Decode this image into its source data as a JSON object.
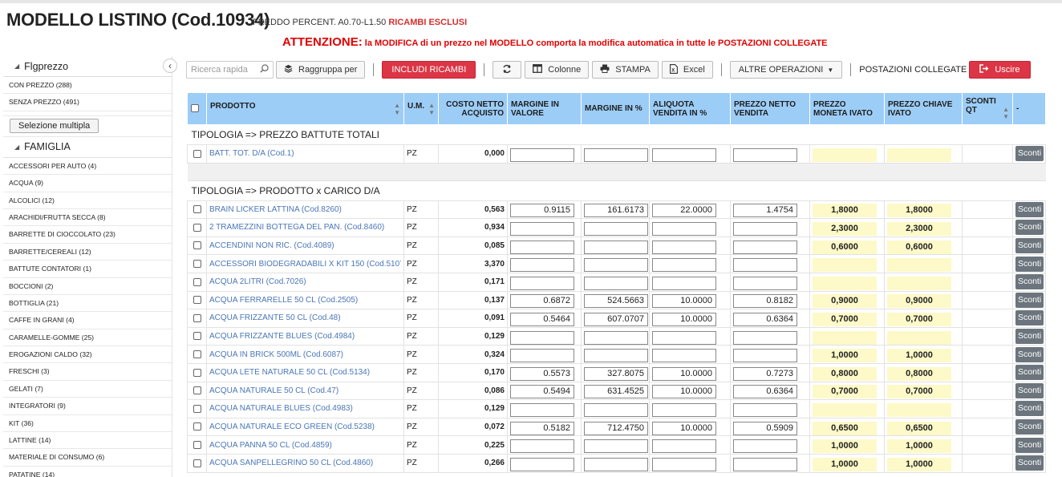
{
  "header": {
    "title": "MODELLO LISTINO (Cod.10934)",
    "subtitle": "FREDDO PERCENT. A0.70-L1.50",
    "subtitle_flag": "RICAMBI ESCLUSI",
    "warning_label": "ATTENZIONE:",
    "warning_text": "la MODIFICA di un prezzo nel MODELLO comporta la modifica automatica in tutte le POSTAZIONI COLLEGATE"
  },
  "sidebar": {
    "collapse_glyph": "‹",
    "flgprezzo_title": "Flgprezzo",
    "flgprezzo_items": [
      "CON PREZZO (288)",
      "SENZA PREZZO (491)"
    ],
    "multi_select_label": "Selezione multipla",
    "famiglia_title": "FAMIGLIA",
    "famiglia_items": [
      "ACCESSORI PER AUTO (4)",
      "ACQUA (9)",
      "ALCOLICI (12)",
      "ARACHIDI/FRUTTA SECCA (8)",
      "BARRETTE DI CIOCCOLATO (23)",
      "BARRETTE/CEREALI (12)",
      "BATTUTE CONTATORI (1)",
      "BOCCIONI (2)",
      "BOTTIGLIA (21)",
      "CAFFE IN GRANI (4)",
      "CARAMELLE-GOMME (25)",
      "EROGAZIONI CALDO (32)",
      "FRESCHI (3)",
      "GELATI (7)",
      "INTEGRATORI (9)",
      "KIT (36)",
      "LATTINE (14)",
      "MATERIALE DI CONSUMO (6)",
      "PATATINE (14)"
    ]
  },
  "toolbar": {
    "search_placeholder": "Ricerca rapida",
    "group_by": "Raggruppa per",
    "include_spares": "INCLUDI RICAMBI",
    "columns": "Colonne",
    "print": "STAMPA",
    "excel": "Excel",
    "other_ops": "ALTRE OPERAZIONI",
    "linked_stations": "POSTAZIONI COLLEGATE",
    "exit": "Uscire"
  },
  "table": {
    "columns": [
      "PRODOTTO",
      "U.M.",
      "COSTO NETTO ACQUISTO",
      "MARGINE IN VALORE",
      "MARGINE IN %",
      "ALIQUOTA VENDITA IN %",
      "PREZZO NETTO VENDITA",
      "PREZZO MONETA IVATO",
      "PREZZO CHIAVE IVATO",
      "SCONTI QT",
      "-"
    ],
    "sconti_label": "Sconti",
    "groups": [
      {
        "title": "TIPOLOGIA => PREZZO BATTUTE TOTALI",
        "rows": [
          {
            "product": "BATT. TOT. D/A (Cod.1)",
            "um": "PZ",
            "cost": "0,000",
            "margin_val": "",
            "margin_pct": "",
            "vat": "",
            "net_price": "",
            "price_coin": "",
            "price_key": ""
          }
        ]
      },
      {
        "title": "TIPOLOGIA => PRODOTTO x CARICO D/A",
        "rows": [
          {
            "product": "BRAIN LICKER LATTINA (Cod.8260)",
            "um": "PZ",
            "cost": "0,563",
            "margin_val": "0.9115",
            "margin_pct": "161.6173",
            "vat": "22.0000",
            "net_price": "1.4754",
            "price_coin": "1,8000",
            "price_key": "1,8000"
          },
          {
            "product": "2 TRAMEZZINI BOTTEGA DEL PAN. (Cod.8460)",
            "um": "PZ",
            "cost": "0,934",
            "margin_val": "",
            "margin_pct": "",
            "vat": "",
            "net_price": "",
            "price_coin": "2,3000",
            "price_key": "2,3000"
          },
          {
            "product": "ACCENDINI NON RIC. (Cod.4089)",
            "um": "PZ",
            "cost": "0,085",
            "margin_val": "",
            "margin_pct": "",
            "vat": "",
            "net_price": "",
            "price_coin": "0,6000",
            "price_key": "0,6000"
          },
          {
            "product": "ACCESSORI BIODEGRADABILI X KIT 150 (Cod.5107)",
            "um": "PZ",
            "cost": "3,370",
            "margin_val": "",
            "margin_pct": "",
            "vat": "",
            "net_price": "",
            "price_coin": "",
            "price_key": ""
          },
          {
            "product": "ACQUA 2LITRI (Cod.7026)",
            "um": "PZ",
            "cost": "0,171",
            "margin_val": "",
            "margin_pct": "",
            "vat": "",
            "net_price": "",
            "price_coin": "",
            "price_key": ""
          },
          {
            "product": "ACQUA FERRARELLE 50 CL (Cod.2505)",
            "um": "PZ",
            "cost": "0,137",
            "margin_val": "0.6872",
            "margin_pct": "524.5663",
            "vat": "10.0000",
            "net_price": "0.8182",
            "price_coin": "0,9000",
            "price_key": "0,9000"
          },
          {
            "product": "ACQUA FRIZZANTE 50 CL (Cod.48)",
            "um": "PZ",
            "cost": "0,091",
            "margin_val": "0.5464",
            "margin_pct": "607.0707",
            "vat": "10.0000",
            "net_price": "0.6364",
            "price_coin": "0,7000",
            "price_key": "0,7000"
          },
          {
            "product": "ACQUA FRIZZANTE BLUES (Cod.4984)",
            "um": "PZ",
            "cost": "0,129",
            "margin_val": "",
            "margin_pct": "",
            "vat": "",
            "net_price": "",
            "price_coin": "",
            "price_key": ""
          },
          {
            "product": "ACQUA IN BRICK 500ML (Cod.6087)",
            "um": "PZ",
            "cost": "0,324",
            "margin_val": "",
            "margin_pct": "",
            "vat": "",
            "net_price": "",
            "price_coin": "1,0000",
            "price_key": "1,0000"
          },
          {
            "product": "ACQUA LETE NATURALE 50 CL (Cod.5134)",
            "um": "PZ",
            "cost": "0,170",
            "margin_val": "0.5573",
            "margin_pct": "327.8075",
            "vat": "10.0000",
            "net_price": "0.7273",
            "price_coin": "0,8000",
            "price_key": "0,8000"
          },
          {
            "product": "ACQUA NATURALE 50 CL (Cod.47)",
            "um": "PZ",
            "cost": "0,086",
            "margin_val": "0.5494",
            "margin_pct": "631.4525",
            "vat": "10.0000",
            "net_price": "0.6364",
            "price_coin": "0,7000",
            "price_key": "0,7000"
          },
          {
            "product": "ACQUA NATURALE BLUES (Cod.4983)",
            "um": "PZ",
            "cost": "0,129",
            "margin_val": "",
            "margin_pct": "",
            "vat": "",
            "net_price": "",
            "price_coin": "",
            "price_key": ""
          },
          {
            "product": "ACQUA NATURALE ECO GREEN (Cod.5238)",
            "um": "PZ",
            "cost": "0,072",
            "margin_val": "0.5182",
            "margin_pct": "712.4750",
            "vat": "10.0000",
            "net_price": "0.5909",
            "price_coin": "0,6500",
            "price_key": "0,6500"
          },
          {
            "product": "ACQUA PANNA 50 CL (Cod.4859)",
            "um": "PZ",
            "cost": "0,225",
            "margin_val": "",
            "margin_pct": "",
            "vat": "",
            "net_price": "",
            "price_coin": "1,0000",
            "price_key": "1,0000"
          },
          {
            "product": "ACQUA SANPELLEGRINO 50 CL (Cod.4860)",
            "um": "PZ",
            "cost": "0,266",
            "margin_val": "",
            "margin_pct": "",
            "vat": "",
            "net_price": "",
            "price_coin": "1,0000",
            "price_key": "1,0000"
          }
        ]
      }
    ]
  }
}
